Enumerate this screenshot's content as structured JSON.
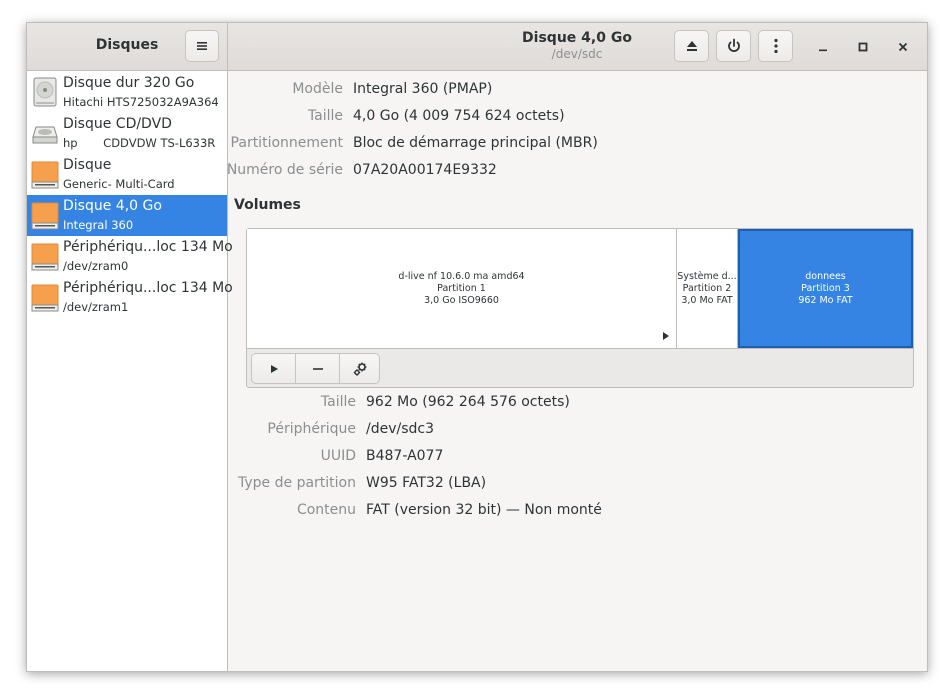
{
  "app": {
    "title": "Disques"
  },
  "header": {
    "title": "Disque 4,0 Go",
    "subtitle": "/dev/sdc"
  },
  "icons": {
    "menu": "hamburger-menu-icon",
    "eject": "eject-icon",
    "power": "power-icon",
    "more": "vertical-dots-icon",
    "minimize": "minimize-icon",
    "maximize": "maximize-icon",
    "close": "close-icon",
    "hdd": "hard-disk-icon",
    "optical": "optical-drive-icon",
    "removable": "removable-drive-icon",
    "start": "play-icon",
    "remove": "minus-icon",
    "settings": "gears-icon"
  },
  "colors": {
    "accent": "#3584e4",
    "drive_orange": "#f6a04d"
  },
  "disks": [
    {
      "name": "Disque dur 320 Go",
      "sub": "Hitachi HTS725032A9A364",
      "icon": "hard-disk-icon"
    },
    {
      "name": "Disque CD/DVD",
      "sub": "hp       CDDVDW TS-L633R",
      "icon": "optical-drive-icon"
    },
    {
      "name": "Disque",
      "sub": "Generic- Multi-Card",
      "icon": "removable-drive-icon"
    },
    {
      "name": "Disque 4,0 Go",
      "sub": "Integral 360",
      "icon": "removable-drive-icon",
      "selected": true
    },
    {
      "name": "Périphériqu...loc 134 Mo",
      "sub": "/dev/zram0",
      "icon": "removable-drive-icon"
    },
    {
      "name": "Périphériqu...loc 134 Mo",
      "sub": "/dev/zram1",
      "icon": "removable-drive-icon"
    }
  ],
  "disk_info": {
    "model_label": "Modèle",
    "model_value": "Integral 360 (PMAP)",
    "size_label": "Taille",
    "size_value": "4,0 Go (4 009 754 624 octets)",
    "partitioning_label": "Partitionnement",
    "partitioning_value": "Bloc de démarrage principal (MBR)",
    "serial_label": "Numéro de série",
    "serial_value": "07A20A00174E9332"
  },
  "volumes": {
    "title": "Volumes",
    "partitions": [
      {
        "name": "d-live nf 10.6.0 ma amd64",
        "part": "Partition 1",
        "size": "3,0 Go ISO9660"
      },
      {
        "name": "Système d...",
        "part": "Partition 2",
        "size": "3,0 Mo FAT"
      },
      {
        "name": "donnees",
        "part": "Partition 3",
        "size": "962 Mo FAT",
        "selected": true
      }
    ]
  },
  "volume_info": {
    "size_label": "Taille",
    "size_value": "962 Mo (962 264 576 octets)",
    "device_label": "Périphérique",
    "device_value": "/dev/sdc3",
    "uuid_label": "UUID",
    "uuid_value": "B487-A077",
    "type_label": "Type de partition",
    "type_value": "W95 FAT32 (LBA)",
    "content_label": "Contenu",
    "content_value": "FAT (version 32 bit) — Non monté"
  }
}
